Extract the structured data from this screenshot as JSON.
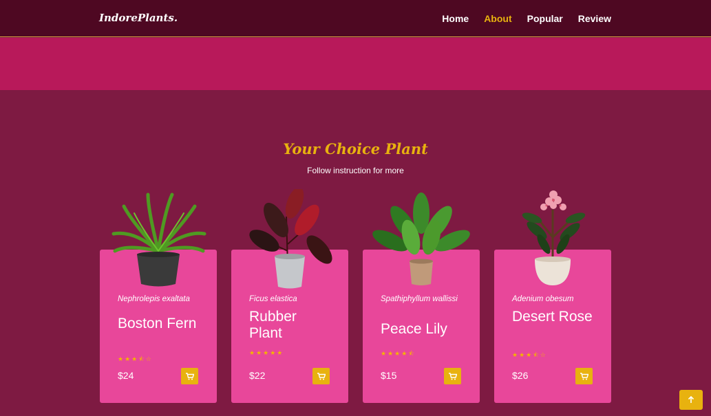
{
  "brand": {
    "logo": "IndorePlants."
  },
  "nav": {
    "items": [
      {
        "label": "Home",
        "active": false
      },
      {
        "label": "About",
        "active": true
      },
      {
        "label": "Popular",
        "active": false
      },
      {
        "label": "Review",
        "active": false
      }
    ]
  },
  "section": {
    "title": "Your Choice Plant",
    "subtitle": "Follow instruction for more"
  },
  "products": [
    {
      "scientific": "Nephrolepis exaltata",
      "name": "Boston Fern",
      "stars": "★★★⯪☆",
      "rating": 3.5,
      "price": "$24",
      "plant_icon": "fern-plant-icon"
    },
    {
      "scientific": "Ficus elastica",
      "name": "Rubber Plant",
      "stars": "★★★★★",
      "rating": 5,
      "price": "$22",
      "plant_icon": "rubber-plant-icon"
    },
    {
      "scientific": "Spathiphyllum wallissi",
      "name": "Peace Lily",
      "stars": "★★★★⯪",
      "rating": 4.5,
      "price": "$15",
      "plant_icon": "peace-lily-icon"
    },
    {
      "scientific": "Adenium obesum",
      "name": "Desert Rose",
      "stars": "★★★⯪☆",
      "rating": 3.5,
      "price": "$26",
      "plant_icon": "desert-rose-icon"
    }
  ],
  "icons": {
    "cart": "cart-icon",
    "scroll_top": "arrow-up-icon"
  },
  "colors": {
    "navbar": "#4e0822",
    "band": "#b8195a",
    "page": "#7e1a42",
    "card": "#e8479a",
    "accent": "#e8b20f"
  }
}
